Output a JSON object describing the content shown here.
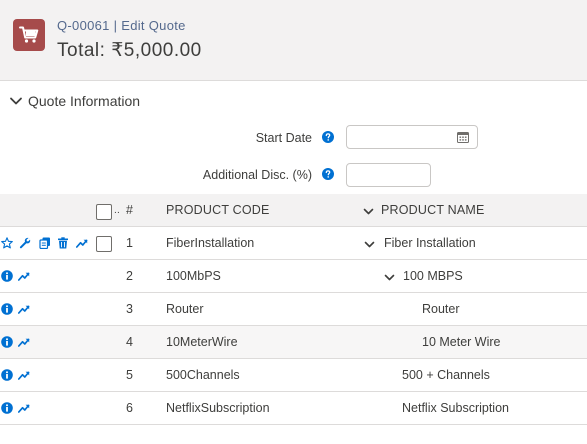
{
  "header": {
    "record_id": "Q-00061",
    "separator": "|",
    "mode": "Edit Quote",
    "total": "Total: ₹5,000.00"
  },
  "section": {
    "title": "Quote Information"
  },
  "form": {
    "start_date_label": "Start Date",
    "start_date_value": "",
    "additional_disc_label": "Additional Disc. (%)",
    "additional_disc_value": ""
  },
  "table": {
    "headers": {
      "number": "#",
      "product_code": "PRODUCT CODE",
      "product_name": "PRODUCT NAME"
    },
    "rows": [
      {
        "num": "1",
        "code": "FiberInstallation",
        "name": "Fiber Installation"
      },
      {
        "num": "2",
        "code": "100MbPS",
        "name": "100 MBPS"
      },
      {
        "num": "3",
        "code": "Router",
        "name": "Router"
      },
      {
        "num": "4",
        "code": "10MeterWire",
        "name": "10 Meter Wire"
      },
      {
        "num": "5",
        "code": "500Channels",
        "name": "500 + Channels"
      },
      {
        "num": "6",
        "code": "NetflixSubscription",
        "name": "Netflix Subscription"
      }
    ]
  },
  "colors": {
    "accent": "#0070d2",
    "header_icon_bg": "#a64b4b"
  }
}
